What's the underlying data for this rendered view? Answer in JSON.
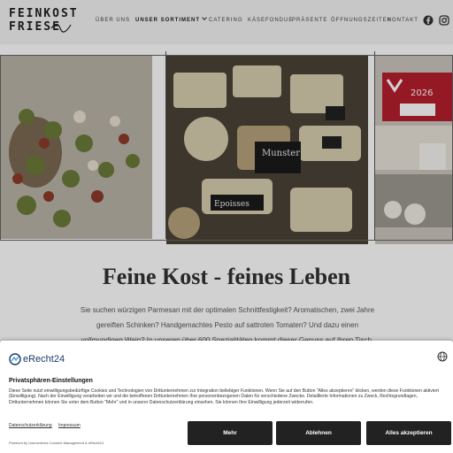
{
  "logo": {
    "line1": "FEINKOST",
    "line2": "FRIESE"
  },
  "nav": {
    "items": [
      {
        "label": "ÜBER UNS",
        "active": false
      },
      {
        "label": "UNSER SORTIMENT",
        "active": true,
        "has_dropdown": true
      },
      {
        "label": "CATERING",
        "active": false
      },
      {
        "label": "KÄSEFONDUE",
        "active": false
      },
      {
        "label": "PRÄSENTE",
        "active": false
      },
      {
        "label": "ÖFFNUNGSZEITEN",
        "active": false
      },
      {
        "label": "KONTAKT",
        "active": false
      }
    ],
    "social": [
      "facebook-icon",
      "instagram-icon"
    ]
  },
  "gallery": {
    "images": [
      "canape-platter",
      "cheese-counter",
      "deli-counter"
    ],
    "sign_text": [
      "Munster",
      "Epoisses"
    ]
  },
  "content": {
    "headline": "Feine Kost - feines Leben",
    "intro": "Sie suchen würzigen Parmesan mit der optimalen Schnittfestigkeit? Aromatischen, zwei Jahre gereiften Schinken? Handgemachtes Pesto auf sattroten Tomaten? Und dazu einen vollmundigen Wein? In unseren über 600 Spezialitäten kommt dieser Genuss auf Ihren Tisch."
  },
  "consent": {
    "brand": "eRecht24",
    "title": "Privatsphären-Einstellungen",
    "body": "Diese Seite nutzt einwilligungsbedürftige Cookies und Technologien von Drittunternehmen zur Integration beliebiger Funktionen. Wenn Sie auf den Button \"Alles akzeptieren\" klicken, werden diese Funktionen aktiviert (Einwilligung). Nach der Einwilligung verarbeiten wir und die betroffenen Drittunternehmen Ihre personenbezogenen Daten für verschiedene Zwecke. Detaillierte Informationen zu Zweck, Rechtsgrundlagen, Drittunternehmen können Sie unter dem Button \"Mehr\" und in unserer Datenschutzerklärung einsehen. Sie können Ihre Einwilligung jederzeit widerrufen.",
    "links": [
      "Datenschutzerklärung",
      "Impressum"
    ],
    "powered": "Powered by Usercentrics Consent Management & eRecht24",
    "buttons": {
      "more": "Mehr",
      "reject": "Ablehnen",
      "accept": "Alles akzeptieren"
    }
  },
  "colors": {
    "header_bg": "#f3f3f3",
    "button_bg": "#222222",
    "brand_blue": "#1b3a6a"
  }
}
